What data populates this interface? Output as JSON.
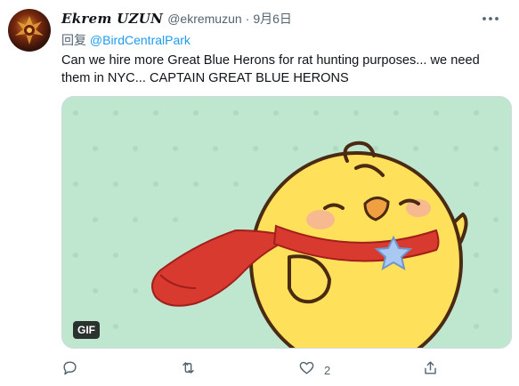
{
  "tweet": {
    "display_name": "Ekrem UZUN",
    "handle": "@ekremuzun",
    "separator": "·",
    "date": "9月6日",
    "reply_prefix": "回复",
    "reply_to": "@BirdCentralPark",
    "text": "Can we hire more Great Blue Herons for rat hunting purposes... we need them in NYC... CAPTAIN GREAT BLUE HERONS",
    "media": {
      "badge": "GIF",
      "background_color": "#bfe6cf",
      "icon": "yellow-chick-with-red-cape"
    },
    "actions": {
      "reply_icon": "comment-icon",
      "retweet_icon": "retweet-icon",
      "like_icon": "heart-icon",
      "like_count": "2",
      "share_icon": "share-icon"
    },
    "colors": {
      "link": "#1d9bf0",
      "secondary_text": "#536471"
    }
  }
}
